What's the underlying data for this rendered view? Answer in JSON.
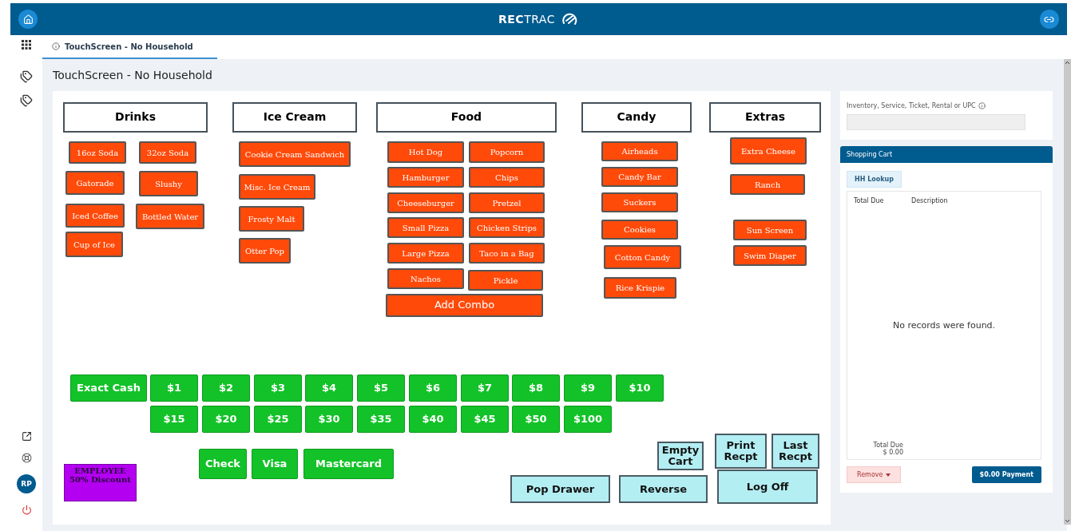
{
  "topbar": {
    "brand": "**REC**TRAC"
  },
  "sidebar": {
    "avatar": "RP"
  },
  "tab": {
    "label": "TouchScreen - No Household",
    "selected": true
  },
  "page_title": "TouchScreen - No Household",
  "touch_buttons": [
    {
      "label": "Drinks",
      "kind": "header"
    },
    {
      "label": "Ice Cream",
      "kind": "header"
    },
    {
      "label": "Food",
      "kind": "header"
    },
    {
      "label": "Candy",
      "kind": "header"
    },
    {
      "label": "Extras",
      "kind": "header"
    },
    {
      "label": "16oz Soda",
      "kind": "item"
    },
    {
      "label": "32oz Soda",
      "kind": "item"
    },
    {
      "label": "Gatorade",
      "kind": "item"
    },
    {
      "label": "Slushy",
      "kind": "item"
    },
    {
      "label": "Iced Coffee",
      "kind": "item"
    },
    {
      "label": "Bottled Water",
      "kind": "item"
    },
    {
      "label": "Cup of Ice",
      "kind": "item"
    },
    {
      "label": "Cookie Cream Sandwich",
      "kind": "item"
    },
    {
      "label": "Misc. Ice Cream",
      "kind": "item"
    },
    {
      "label": "Frosty Malt",
      "kind": "item"
    },
    {
      "label": "Otter Pop",
      "kind": "item"
    },
    {
      "label": "Hot Dog",
      "kind": "item"
    },
    {
      "label": "Popcorn",
      "kind": "item"
    },
    {
      "label": "Hamburger",
      "kind": "item"
    },
    {
      "label": "Chips",
      "kind": "item"
    },
    {
      "label": "Cheeseburger",
      "kind": "item"
    },
    {
      "label": "Pretzel",
      "kind": "item"
    },
    {
      "label": "Small Pizza",
      "kind": "item"
    },
    {
      "label": "Chicken Strips",
      "kind": "item"
    },
    {
      "label": "Large Pizza",
      "kind": "item"
    },
    {
      "label": "Taco in a Bag",
      "kind": "item"
    },
    {
      "label": "Nachos",
      "kind": "item"
    },
    {
      "label": "Pickle",
      "kind": "item"
    },
    {
      "label": "Add Combo",
      "kind": "combo"
    },
    {
      "label": "Airheads",
      "kind": "item"
    },
    {
      "label": "Candy Bar",
      "kind": "item"
    },
    {
      "label": "Suckers",
      "kind": "item"
    },
    {
      "label": "Cookies",
      "kind": "item"
    },
    {
      "label": "Cotton Candy",
      "kind": "item"
    },
    {
      "label": "Rice Krispie",
      "kind": "item"
    },
    {
      "label": "Extra Cheese",
      "kind": "item"
    },
    {
      "label": "Ranch",
      "kind": "item"
    },
    {
      "label": "Sun Screen",
      "kind": "item"
    },
    {
      "label": "Swim Diaper",
      "kind": "item"
    },
    {
      "label": "Exact Cash",
      "kind": "cash"
    },
    {
      "label": "$1",
      "kind": "cash"
    },
    {
      "label": "$2",
      "kind": "cash"
    },
    {
      "label": "$3",
      "kind": "cash"
    },
    {
      "label": "$4",
      "kind": "cash"
    },
    {
      "label": "$5",
      "kind": "cash"
    },
    {
      "label": "$6",
      "kind": "cash"
    },
    {
      "label": "$7",
      "kind": "cash"
    },
    {
      "label": "$8",
      "kind": "cash"
    },
    {
      "label": "$9",
      "kind": "cash"
    },
    {
      "label": "$10",
      "kind": "cash"
    },
    {
      "label": "$15",
      "kind": "cash"
    },
    {
      "label": "$20",
      "kind": "cash"
    },
    {
      "label": "$25",
      "kind": "cash"
    },
    {
      "label": "$30",
      "kind": "cash"
    },
    {
      "label": "$35",
      "kind": "cash"
    },
    {
      "label": "$40",
      "kind": "cash"
    },
    {
      "label": "$45",
      "kind": "cash"
    },
    {
      "label": "$50",
      "kind": "cash"
    },
    {
      "label": "$100",
      "kind": "cash"
    },
    {
      "label": "Check",
      "kind": "cash"
    },
    {
      "label": "Visa",
      "kind": "cash"
    },
    {
      "label": "Mastercard",
      "kind": "cash"
    },
    {
      "label": "EMPLOYEE\n50% Discount",
      "kind": "discount"
    },
    {
      "label": "Empty\nCart",
      "kind": "action"
    },
    {
      "label": "Print\nRecpt",
      "kind": "action"
    },
    {
      "label": "Last\nRecpt",
      "kind": "action"
    },
    {
      "label": "Pop Drawer",
      "kind": "action"
    },
    {
      "label": "Reverse",
      "kind": "action"
    },
    {
      "label": "Log Off",
      "kind": "action"
    }
  ],
  "lookup": {
    "label": "Inventory, Service, Ticket, Rental or UPC"
  },
  "cart": {
    "title": "Shopping Cart",
    "hh_lookup": "HH Lookup",
    "columns": [
      "Total Due",
      "Description"
    ],
    "empty_message": "No records were found.",
    "total_label": "Total Due",
    "total_value": "$ 0.00",
    "remove": "Remove",
    "payment": "$0.00 Payment"
  }
}
